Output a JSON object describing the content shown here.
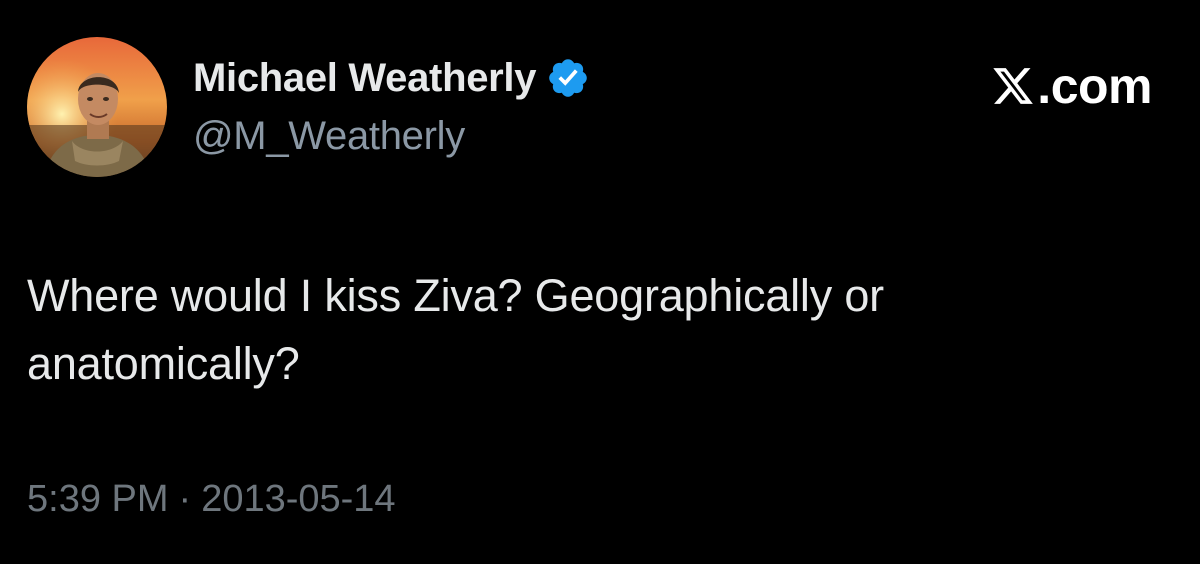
{
  "author": {
    "display_name": "Michael Weatherly",
    "handle": "@M_Weatherly",
    "verified": true
  },
  "brand": {
    "label": ".com",
    "logo": "x-logo-icon"
  },
  "tweet": {
    "text": "Where would I kiss Ziva? Geographically or anatomically?",
    "time": "5:39 PM",
    "separator": "·",
    "date": "2013-05-14"
  },
  "colors": {
    "background": "#000000",
    "text_primary": "#e7e9ea",
    "text_secondary": "#8b98a5",
    "verified_blue": "#1d9bf0"
  }
}
